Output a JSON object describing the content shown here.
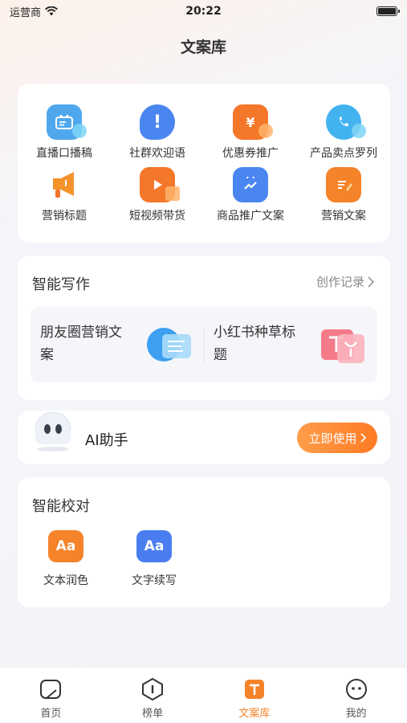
{
  "status": {
    "carrier": "运营商",
    "time": "20:22"
  },
  "title": "文案库",
  "categories": [
    {
      "label": "直播口播稿",
      "icon": "live-script-icon",
      "color": "#4fa8ee"
    },
    {
      "label": "社群欢迎语",
      "icon": "welcome-bubble-icon",
      "color": "#4a86f0"
    },
    {
      "label": "优惠券推广",
      "icon": "coupon-icon",
      "color": "#f5772a"
    },
    {
      "label": "产品卖点罗列",
      "icon": "product-chat-icon",
      "color": "#43b3f0"
    },
    {
      "label": "营销标题",
      "icon": "megaphone-icon",
      "color": "#f58a2c"
    },
    {
      "label": "短视频带货",
      "icon": "video-icon",
      "color": "#f5772a"
    },
    {
      "label": "商品推广文案",
      "icon": "shopping-bag-icon",
      "color": "#4a86f0"
    },
    {
      "label": "营销文案",
      "icon": "edit-doc-icon",
      "color": "#f5832a"
    }
  ],
  "writing": {
    "title": "智能写作",
    "history_link": "创作记录",
    "items": [
      {
        "label": "朋友圈营销文案",
        "icon": "moments-icon"
      },
      {
        "label": "小红书种草标题",
        "icon": "xiaohongshu-icon"
      }
    ]
  },
  "assistant": {
    "label": "AI助手",
    "button": "立即使用"
  },
  "proofread": {
    "title": "智能校对",
    "items": [
      {
        "label": "文本润色",
        "icon_text": "Aa",
        "color": "#f5832a"
      },
      {
        "label": "文字续写",
        "icon_text": "Aa",
        "color": "#4a7ef0"
      }
    ]
  },
  "tabs": [
    {
      "label": "首页",
      "icon": "home-icon"
    },
    {
      "label": "榜单",
      "icon": "ranking-icon"
    },
    {
      "label": "文案库",
      "icon": "library-icon",
      "active": true
    },
    {
      "label": "我的",
      "icon": "profile-icon"
    }
  ],
  "colors": {
    "accent": "#f5832a",
    "accent_gradient_end": "#ff7a24",
    "text_primary": "#222222",
    "text_secondary": "#888888"
  }
}
